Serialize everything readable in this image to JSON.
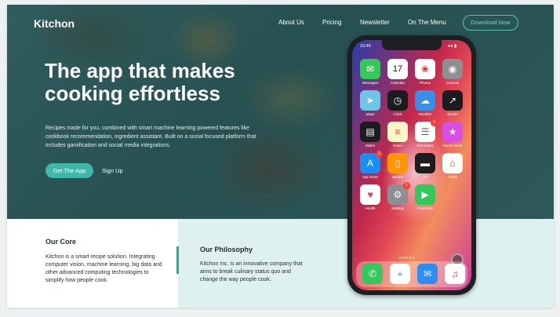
{
  "brand": "Kitchon",
  "nav": {
    "about": "About Us",
    "pricing": "Pricing",
    "newsletter": "Newsletter",
    "menu": "On The Menu",
    "download": "Download Now"
  },
  "hero": {
    "headline": "The app that makes cooking effortless",
    "subtext": "Recipes made for you, combined with smart machine learning powered features like cookbook recommendation, ingredient assistant. Built on a social focused platform that includes gamification and social media integrations.",
    "cta": "Get The App",
    "signup": "Sign Up"
  },
  "core": {
    "title": "Our Core",
    "text": "Kitchon is a smart recipe solution. Integrating computer vision, machine learning, big data and other advanced computing technologies to simplify how people cook."
  },
  "philosophy": {
    "title": "Our Philosophy",
    "text": "Kitchon Inc. is an innovative company that aims to break culinary status quo and change the way people cook."
  },
  "phone": {
    "time": "10:46",
    "apps": [
      {
        "label": "Messages",
        "icon": "messages-icon",
        "color": "#34c759"
      },
      {
        "label": "Calendar",
        "icon": "calendar-icon",
        "color": "#ffffff",
        "glyph": "17"
      },
      {
        "label": "Photos",
        "icon": "photos-icon",
        "color": "#ffffff"
      },
      {
        "label": "Camera",
        "icon": "camera-icon",
        "color": "#8e8e93"
      },
      {
        "label": "Maps",
        "icon": "maps-icon",
        "color": "#6fc3e6"
      },
      {
        "label": "Clock",
        "icon": "clock-icon",
        "color": "#1c1c1e"
      },
      {
        "label": "Weather",
        "icon": "weather-icon",
        "color": "#3a8ee6"
      },
      {
        "label": "Stocks",
        "icon": "stocks-icon",
        "color": "#1c1c1e"
      },
      {
        "label": "Wallet",
        "icon": "wallet-icon",
        "color": "#1c1c1e"
      },
      {
        "label": "Notes",
        "icon": "notes-icon",
        "color": "#fff6c8"
      },
      {
        "label": "Reminders",
        "icon": "reminders-icon",
        "color": "#ffffff",
        "badge": "4"
      },
      {
        "label": "iTunes Store",
        "icon": "itunes-store-icon",
        "color": "#d84ee0"
      },
      {
        "label": "App Store",
        "icon": "app-store-icon",
        "color": "#1a8cf2",
        "badge": "2"
      },
      {
        "label": "iBooks",
        "icon": "ibooks-icon",
        "color": "#ff9500"
      },
      {
        "label": "TV",
        "icon": "tv-icon",
        "color": "#1c1c1e"
      },
      {
        "label": "Home",
        "icon": "home-icon",
        "color": "#ffffff"
      },
      {
        "label": "Health",
        "icon": "health-icon",
        "color": "#ffffff"
      },
      {
        "label": "Settings",
        "icon": "settings-icon",
        "color": "#8e8e93",
        "badge": "1"
      },
      {
        "label": "FaceTime",
        "icon": "facetime-icon",
        "color": "#34c759"
      }
    ],
    "dock": [
      {
        "icon": "phone-icon",
        "color": "#34c759"
      },
      {
        "icon": "safari-icon",
        "color": "#ffffff"
      },
      {
        "icon": "mail-icon",
        "color": "#2f8cf0"
      },
      {
        "icon": "music-icon",
        "color": "#ffffff"
      }
    ]
  }
}
